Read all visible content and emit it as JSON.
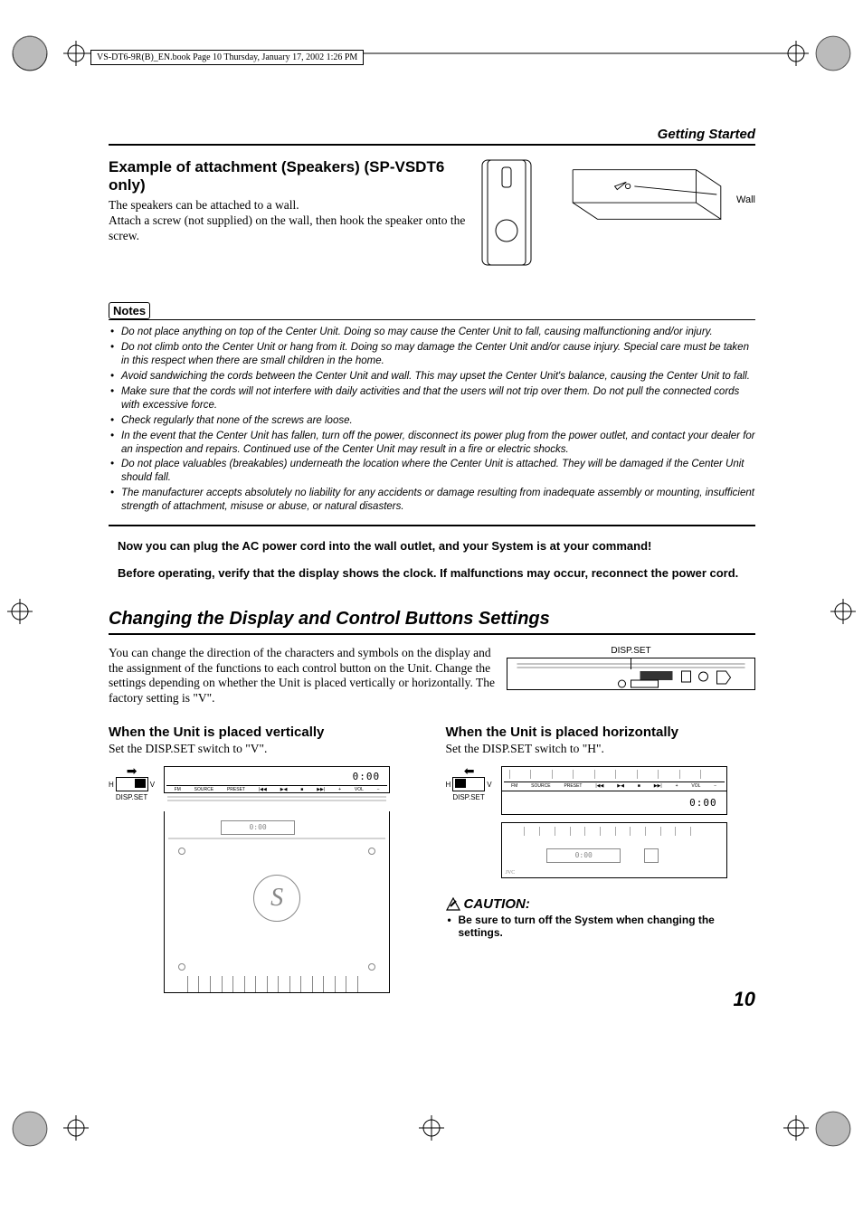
{
  "book_header": "VS-DT6-9R(B)_EN.book  Page 10  Thursday, January 17, 2002  1:26 PM",
  "section_header": "Getting Started",
  "attachment": {
    "heading": "Example of attachment (Speakers) (SP-VSDT6 only)",
    "p1": "The speakers can be attached to a wall.",
    "p2": "Attach a screw (not supplied) on the wall, then hook the speaker onto the screw.",
    "wall_label": "Wall"
  },
  "notes_label": "Notes",
  "notes": [
    "Do not place anything on top of the Center Unit. Doing so may cause the Center Unit to fall, causing malfunctioning and/or injury.",
    "Do not climb onto the Center Unit or hang from it. Doing so may damage the Center Unit and/or cause injury. Special care must be taken in this respect when there are small children in the home.",
    "Avoid sandwiching the cords between the Center Unit and wall. This may upset the Center Unit's balance, causing the Center Unit to fall.",
    "Make sure that the cords will not interfere with daily activities and that the users will not trip over them. Do not pull the connected cords with excessive force.",
    "Check regularly that none of the screws are loose.",
    "In the event that the Center Unit has fallen, turn off the power, disconnect its power plug from the power outlet, and contact your dealer for an inspection and repairs. Continued use of the Center Unit may result in a fire or electric shocks.",
    "Do not place valuables (breakables) underneath the location where the Center Unit is attached. They will be damaged if the Center Unit should fall.",
    "The manufacturer accepts absolutely no liability for any accidents or damage resulting from inadequate assembly or mounting, insufficient strength of attachment, misuse or abuse, or natural disasters."
  ],
  "bold1": "Now you can plug the AC power cord into the wall outlet, and your System is at your command!",
  "bold2": "Before operating, verify that the display shows the clock. If malfunctions may occur, reconnect the power cord.",
  "changing": {
    "heading": "Changing the Display and Control Buttons Settings",
    "intro": "You can change the direction of the characters and symbols on the display and the assignment of the functions to each control button on the Unit. Change the settings depending on whether the Unit is placed vertically or horizontally. The factory setting is \"V\".",
    "dispset_label": "DISP.SET"
  },
  "vertical": {
    "heading": "When the Unit is placed vertically",
    "instruction": "Set the DISP.SET switch to \"V\".",
    "switch_h": "H",
    "switch_v": "V",
    "dispset_label": "DISP.SET",
    "time": "0:00"
  },
  "horizontal": {
    "heading": "When the Unit is placed horizontally",
    "instruction": "Set the DISP.SET switch to \"H\".",
    "switch_h": "H",
    "switch_v": "V",
    "dispset_label": "DISP.SET",
    "time": "0:00"
  },
  "caution": {
    "heading": "CAUTION:",
    "item": "Be sure to turn off the System when changing the settings."
  },
  "page_number": "10"
}
